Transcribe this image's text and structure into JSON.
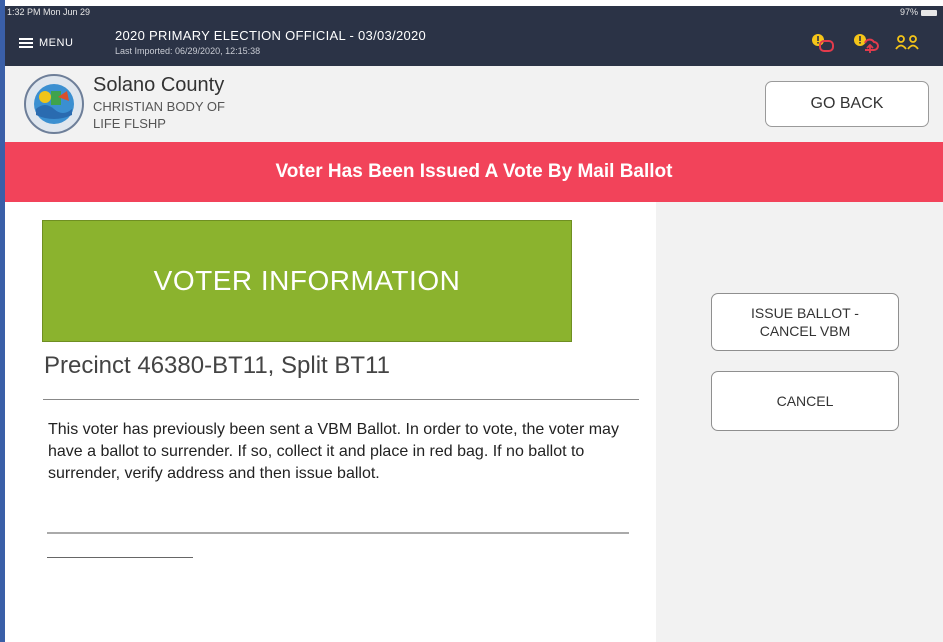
{
  "status_bar": {
    "time": "1:32 PM  Mon Jun 29",
    "battery": "97%"
  },
  "topbar": {
    "menu_label": "MENU",
    "election_title": "2020 PRIMARY ELECTION OFFICIAL - 03/03/2020",
    "last_imported": "Last Imported: 06/29/2020, 12:15:38",
    "icons": [
      "voter-alert-icon",
      "upload-alert-icon",
      "users-icon"
    ],
    "icon_color": "#f5c518"
  },
  "header": {
    "county": "Solano County",
    "site_line1": "CHRISTIAN BODY OF",
    "site_line2": "LIFE FLSHP",
    "go_back_label": "GO BACK"
  },
  "alert": {
    "text": "Voter Has Been Issued A Vote By Mail Ballot",
    "color": "#f2435a"
  },
  "voter": {
    "section_title": "VOTER INFORMATION",
    "section_color": "#8bb32e",
    "precinct": "Precinct 46380-BT11, Split BT11",
    "message": "This voter has previously been sent a VBM Ballot. In order to vote, the voter may have a ballot to surrender.  If so, collect it and place in red bag.  If no ballot to surrender, verify address and then issue ballot."
  },
  "actions": {
    "issue_line1": "ISSUE BALLOT -",
    "issue_line2": "CANCEL VBM",
    "cancel_label": "CANCEL"
  }
}
